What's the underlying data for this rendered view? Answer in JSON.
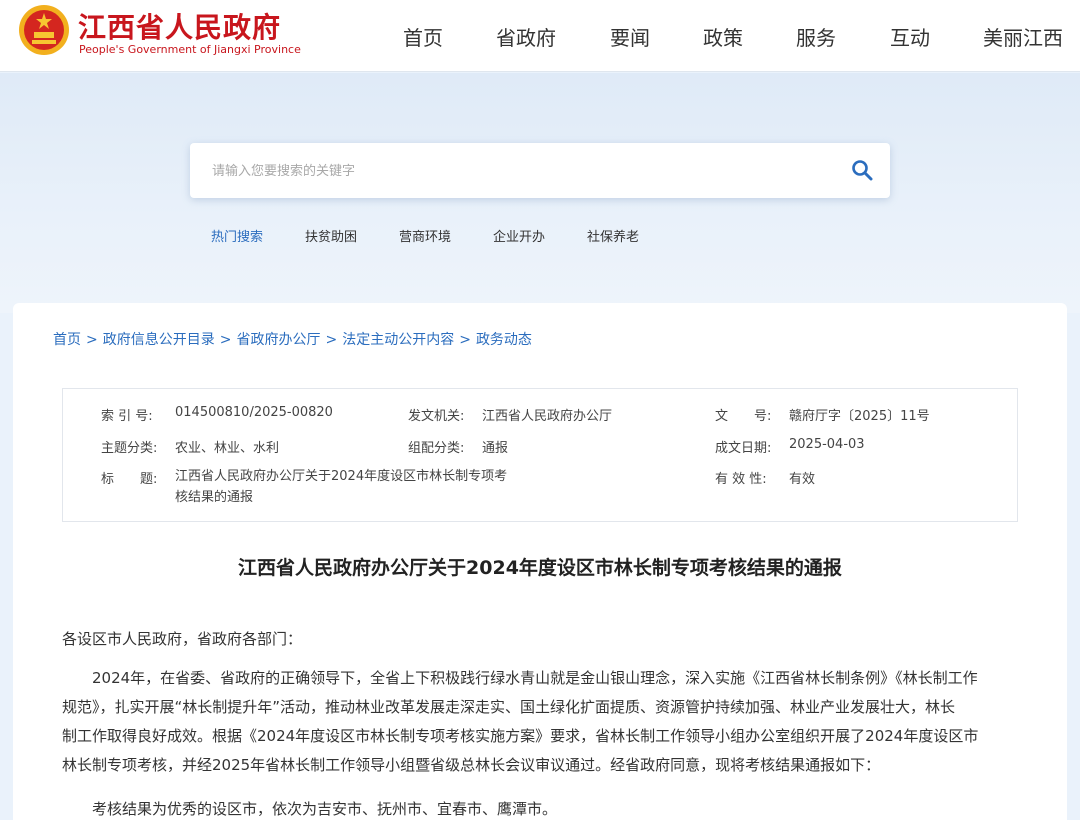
{
  "site": {
    "name_cn": "江西省人民政府",
    "name_en": "People's Government of Jiangxi Province"
  },
  "nav": [
    "首页",
    "省政府",
    "要闻",
    "政策",
    "服务",
    "互动",
    "美丽江西"
  ],
  "search": {
    "placeholder": "请输入您要搜索的关键字",
    "hot_label": "热门搜索",
    "hot_terms": [
      "扶贫助困",
      "营商环境",
      "企业开办",
      "社保养老"
    ]
  },
  "breadcrumb": [
    "首页",
    "政府信息公开目录",
    "省政府办公厅",
    "法定主动公开内容",
    "政务动态"
  ],
  "meta": {
    "index_label": "索 引 号:",
    "index_value": "014500810/2025-00820",
    "issuer_label": "发文机关:",
    "issuer_value": "江西省人民政府办公厅",
    "docno_label": "文　　号:",
    "docno_value": "赣府厅字〔2025〕11号",
    "topic_label": "主题分类:",
    "topic_value": "农业、林业、水利",
    "genre_label": "组配分类:",
    "genre_value": "通报",
    "date_label": "成文日期:",
    "date_value": "2025-04-03",
    "title_label": "标　　题:",
    "title_value_line1": "江西省人民政府办公厅关于2024年度设区市林长制专项考",
    "title_value_line2": "核结果的通报",
    "validity_label": "有 效 性:",
    "validity_value": "有效"
  },
  "document": {
    "title": "江西省人民政府办公厅关于2024年度设区市林长制专项考核结果的通报",
    "salutation": "各设区市人民政府，省政府各部门：",
    "para1_lines": [
      "2024年，在省委、省政府的正确领导下，全省上下积极践行绿水青山就是金山银山理念，深入实施《江西省林长制条例》《林长制工作",
      "规范》，扎实开展“林长制提升年”活动，推动林业改革发展走深走实、国土绿化扩面提质、资源管护持续加强、林业产业发展壮大，林长",
      "制工作取得良好成效。根据《2024年度设区市林长制专项考核实施方案》要求，省林长制工作领导小组办公室组织开展了2024年度设区市",
      "林长制专项考核，并经2025年省林长制工作领导小组暨省级总林长会议审议通过。经省政府同意，现将考核结果通报如下："
    ],
    "para2": "考核结果为优秀的设区市，依次为吉安市、抚州市、宜春市、鹰潭市。"
  },
  "colors": {
    "brand_red": "#c8161d",
    "link_blue": "#2b6dbe",
    "emblem_gold": "#f2b01e"
  }
}
